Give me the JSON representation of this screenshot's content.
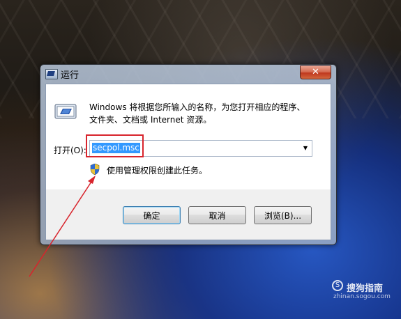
{
  "window": {
    "title": "运行",
    "close_glyph": "✕"
  },
  "content": {
    "description_line1": "Windows 将根据您所输入的名称，为您打开相应的程序、",
    "description_line2": "文件夹、文档或 Internet 资源。",
    "open_label": "打开(O):",
    "open_value": "secpol.msc",
    "admin_note": "使用管理权限创建此任务。"
  },
  "buttons": {
    "ok": "确定",
    "cancel": "取消",
    "browse": "浏览(B)..."
  },
  "watermark": {
    "brand": "搜狗指南",
    "url": "zhinan.sogou.com",
    "icon_glyph": "S"
  },
  "colors": {
    "selection": "#3399ff",
    "annotation_red": "#d8242c",
    "close_red": "#c0391f"
  },
  "icons": {
    "window": "run-app-icon",
    "run": "run-program-icon",
    "shield": "uac-shield-icon",
    "dropdown": "chevron-down-icon"
  }
}
